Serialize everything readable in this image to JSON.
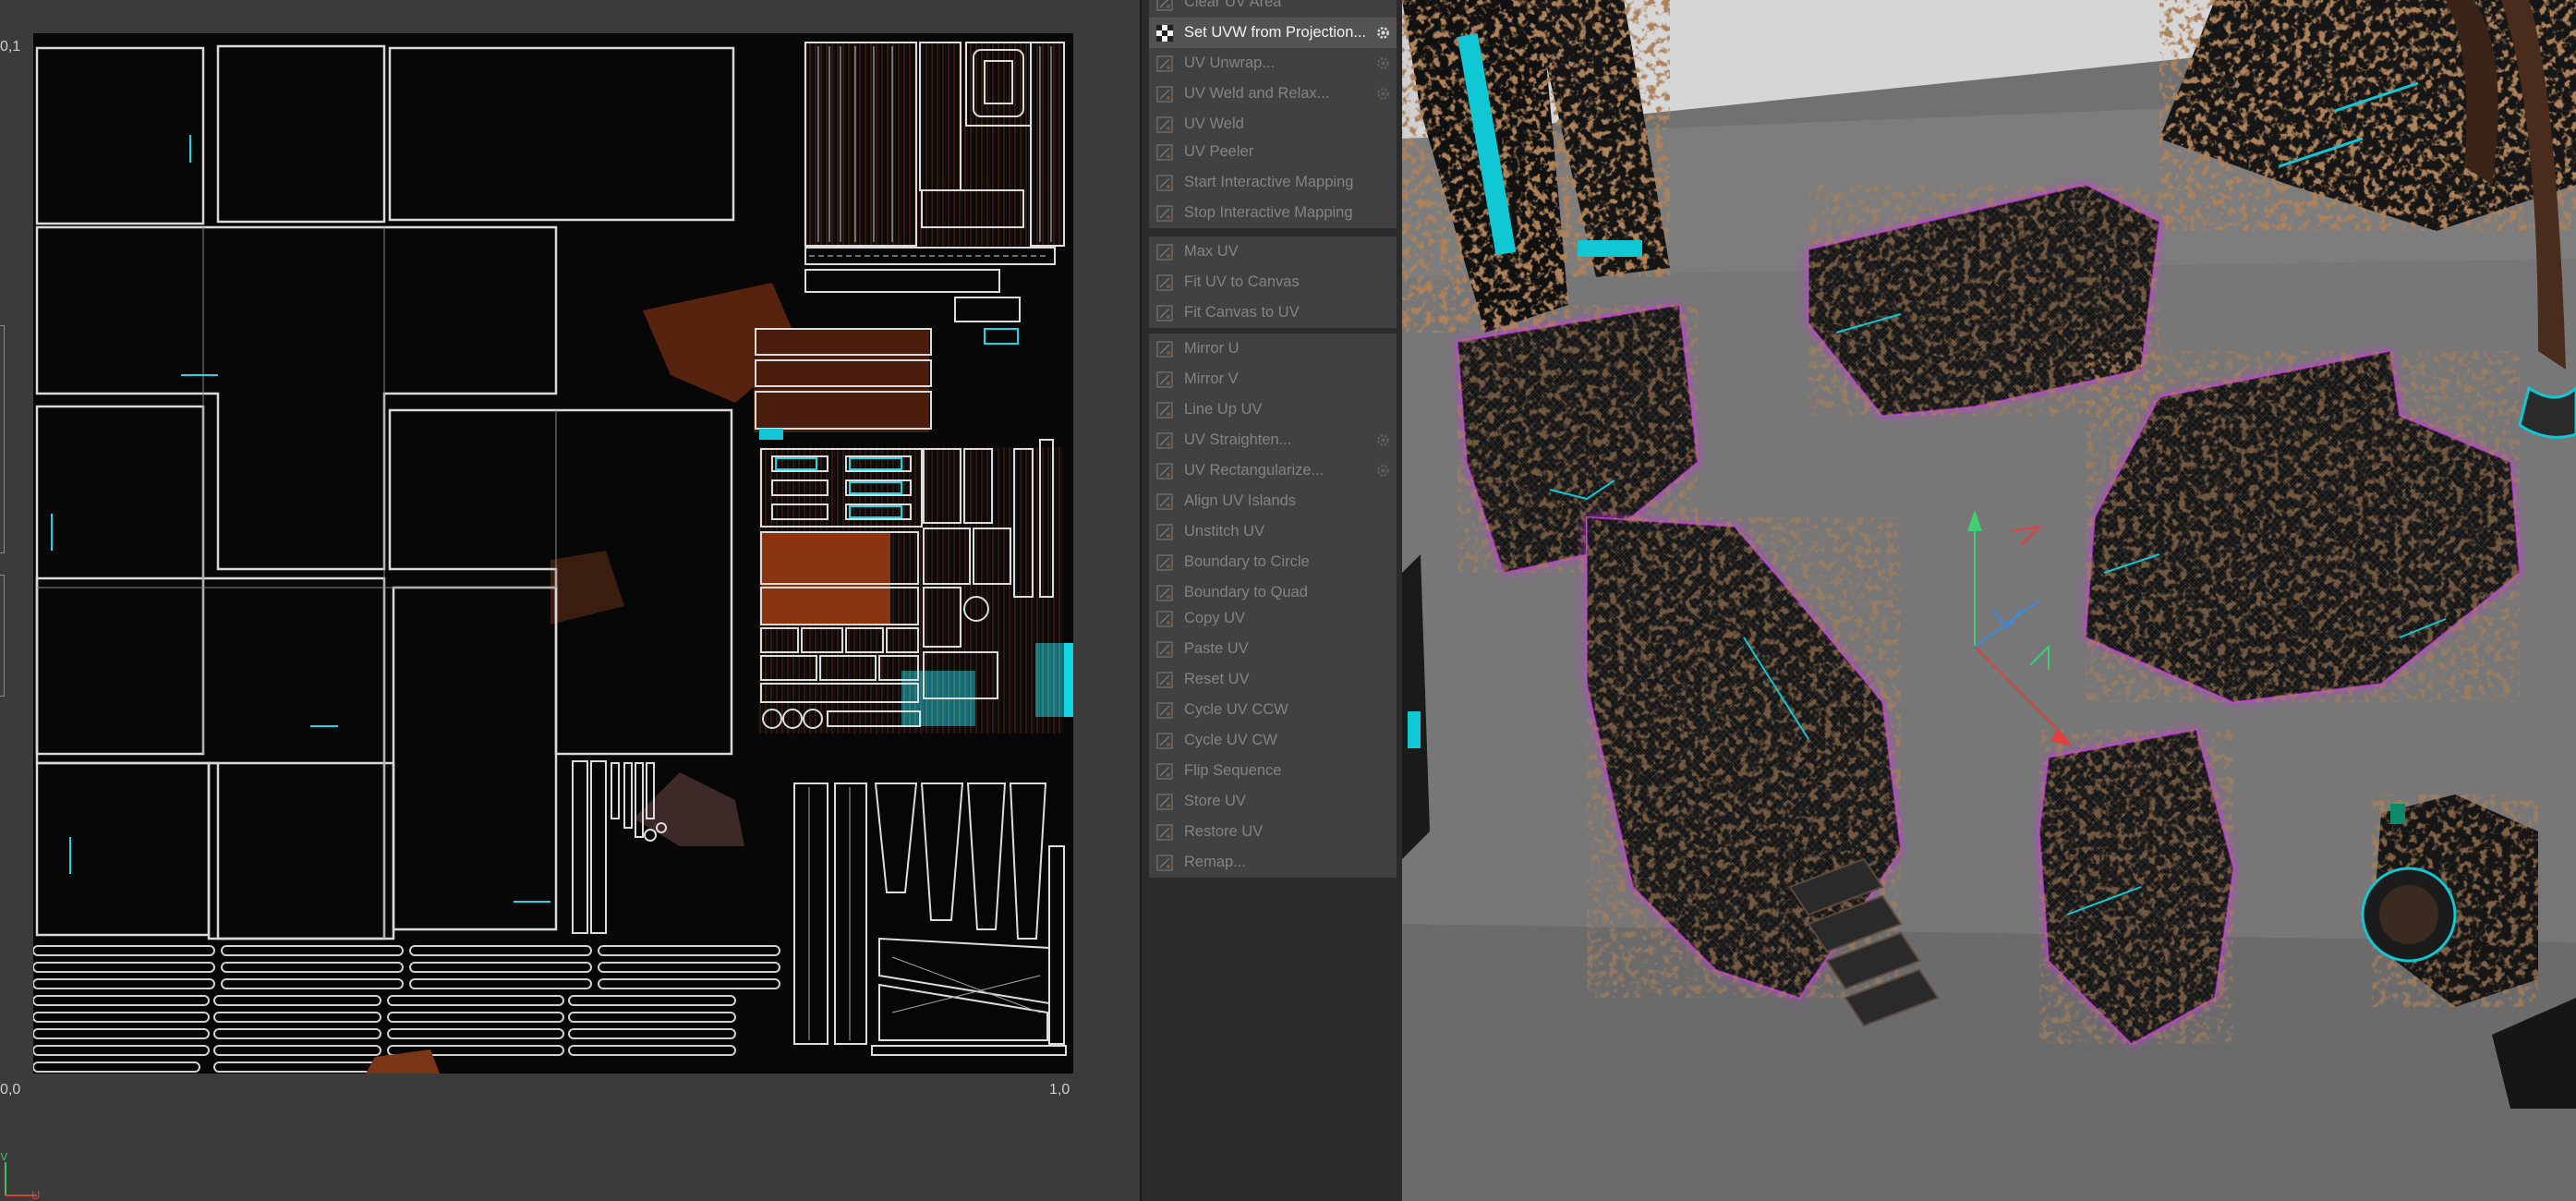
{
  "uv_editor": {
    "coord_top_left": "0,1",
    "coord_bottom_left": "0,0",
    "coord_bottom_right": "1,0",
    "axis_v": "V",
    "axis_u": "U"
  },
  "menu": {
    "groups": [
      [
        {
          "label": "Clear UV Area",
          "icon": "clear-icon",
          "gear": false,
          "active": false
        },
        {
          "label": "Set UVW from Projection...",
          "icon": "checker-icon",
          "gear": true,
          "active": true
        },
        {
          "label": "UV Unwrap...",
          "icon": "unwrap-icon",
          "gear": true,
          "active": false
        },
        {
          "label": "UV Weld and Relax...",
          "icon": "weld-relax-icon",
          "gear": true,
          "active": false
        },
        {
          "label": "UV Weld",
          "icon": "weld-icon",
          "gear": false,
          "active": false
        }
      ],
      [
        {
          "label": "UV Peeler",
          "icon": "peeler-icon",
          "gear": false,
          "active": false
        },
        {
          "label": "Start Interactive Mapping",
          "icon": "start-mapping-icon",
          "gear": false,
          "active": false
        },
        {
          "label": "Stop Interactive Mapping",
          "icon": "stop-mapping-icon",
          "gear": false,
          "active": false
        }
      ],
      [
        {
          "label": "Max UV",
          "icon": "max-uv-icon",
          "gear": false,
          "active": false
        },
        {
          "label": "Fit UV to Canvas",
          "icon": "fit-uv-icon",
          "gear": false,
          "active": false
        },
        {
          "label": "Fit Canvas to UV",
          "icon": "fit-canvas-icon",
          "gear": false,
          "active": false
        }
      ],
      [
        {
          "label": "Mirror U",
          "icon": "mirror-u-icon",
          "gear": false,
          "active": false
        },
        {
          "label": "Mirror V",
          "icon": "mirror-v-icon",
          "gear": false,
          "active": false
        },
        {
          "label": "Line Up UV",
          "icon": "line-up-icon",
          "gear": false,
          "active": false
        },
        {
          "label": "UV Straighten...",
          "icon": "straighten-icon",
          "gear": true,
          "active": false
        },
        {
          "label": "UV Rectangularize...",
          "icon": "rectangularize-icon",
          "gear": true,
          "active": false
        },
        {
          "label": "Align UV Islands",
          "icon": "align-islands-icon",
          "gear": false,
          "active": false
        },
        {
          "label": "Unstitch UV",
          "icon": "unstitch-icon",
          "gear": false,
          "active": false
        },
        {
          "label": "Boundary to Circle",
          "icon": "boundary-circle-icon",
          "gear": false,
          "active": false
        },
        {
          "label": "Boundary to Quad",
          "icon": "boundary-quad-icon",
          "gear": false,
          "active": false
        }
      ],
      [
        {
          "label": "Copy UV",
          "icon": "copy-icon",
          "gear": false,
          "active": false
        },
        {
          "label": "Paste UV",
          "icon": "paste-icon",
          "gear": false,
          "active": false
        },
        {
          "label": "Reset UV",
          "icon": "reset-icon",
          "gear": false,
          "active": false
        },
        {
          "label": "Cycle UV CCW",
          "icon": "cycle-ccw-icon",
          "gear": false,
          "active": false
        },
        {
          "label": "Cycle UV CW",
          "icon": "cycle-cw-icon",
          "gear": false,
          "active": false
        },
        {
          "label": "Flip Sequence",
          "icon": "flip-sequence-icon",
          "gear": false,
          "active": false
        },
        {
          "label": "Store UV",
          "icon": "store-icon",
          "gear": false,
          "active": false
        },
        {
          "label": "Restore UV",
          "icon": "restore-icon",
          "gear": false,
          "active": false
        },
        {
          "label": "Remap...",
          "icon": "remap-icon",
          "gear": false,
          "active": false
        }
      ]
    ]
  },
  "colors": {
    "selection_outline": "#c23bd8",
    "emissive": "#14d6e0",
    "rust": "#7a3516",
    "gizmo_x": "#e04040",
    "gizmo_y": "#40d070",
    "gizmo_z": "#3a8ae0"
  }
}
